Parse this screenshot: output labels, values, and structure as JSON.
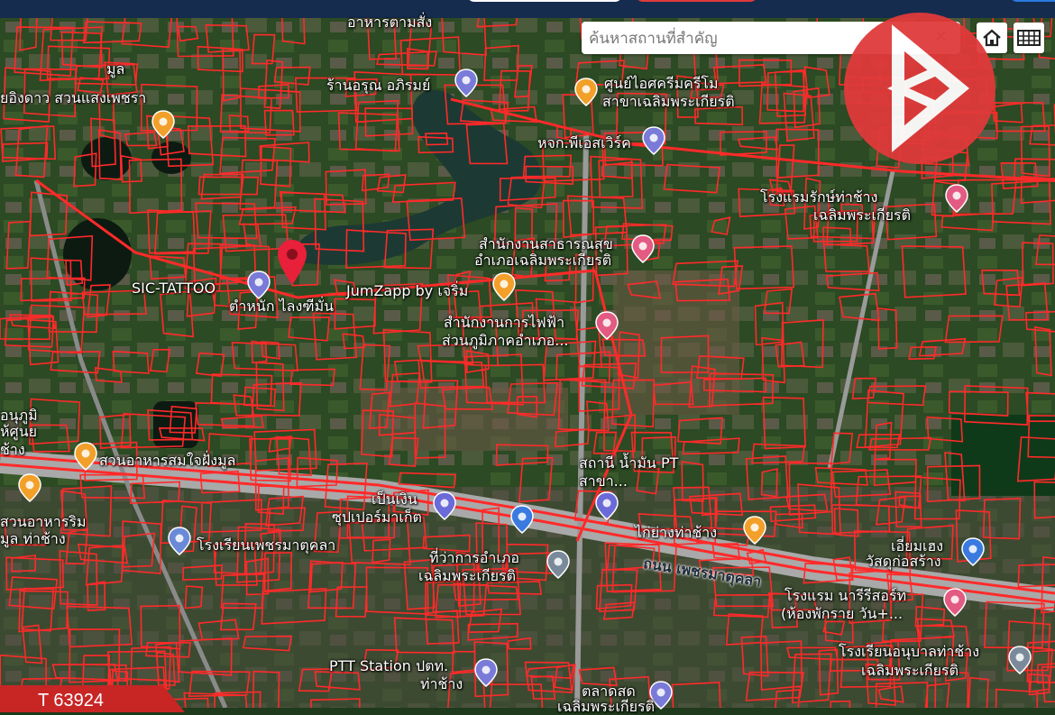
{
  "search": {
    "placeholder": "ค้นหาสถานที่สำคัญ",
    "value": ""
  },
  "controls": {
    "home_icon": "home-icon",
    "grid_icon": "grid-icon",
    "clear_icon": "close-icon"
  },
  "colors": {
    "parcel_lines": "#ff2a2a",
    "road": "#a9a9a9",
    "water": "#1c3a33",
    "logo": "#e03a3a",
    "marker": "#e8203a"
  },
  "labels": {
    "l1": "อาหารตามสั่ง",
    "l2": "มูล",
    "l3": "ยอิงดาว สวนแสงเพชรา",
    "l4": "ร้านอรุณ อภิรมย์",
    "l5": "ศูนย์ไอศครีมครีโม",
    "l6": "สาขาเฉลิมพระเกียรติ",
    "l7": "หจก.พีเอสเวิร์ค",
    "l8": "โรงแรมรักษ์ท่าช้าง",
    "l9": "เฉลิมพระเกียรติ",
    "l10": "สำนักงานสาธารณสุข",
    "l11": "อำเภอเฉลิมพระเกียรติ",
    "l12": "SIC-TATTOO",
    "l13": "ตำหนัก ไลงฑีมั่น",
    "l14": "JumZapp by เจริ่ม",
    "l15": "สำนักงานการไฟฟ้า",
    "l16": "ส่วนภูมิภาคอำเภอ...",
    "l17": "อนุภูมิ",
    "l18": "ห้ศูนย",
    "l19": "ช้าง",
    "l20": "สวนอาหารสมใจฝั่งมูล",
    "l21": "สถานี น้ำมัน PT",
    "l22": "สาขา...",
    "l23": "สวนอาหารริม",
    "l24": "มูล ท่าช้าง",
    "l25": "เป็นเงิน",
    "l26": "ซุปเปอร์มาเก็ต",
    "l27": "โรงเรียนเพชรมาตุคลา",
    "l28": "ไก่ย่างท่าช้าง",
    "l29": "ที่ว่าการอำเภอ",
    "l30": "เฉลิมพระเกียรติ",
    "l31": "ถนน เพชรมาตุคลา",
    "l32": "เอี่ยมเฮง",
    "l33": "วัสดุก่อสร้าง",
    "l34": "โรงแรม นารีรีสอร์ท",
    "l35": "(ห้องพักราย วัน+...",
    "l36": "โรงเรียนอนุบาลท่าช้าง",
    "l37": "เฉลิมพระเกียรติ",
    "l38": "PTT Station ปตท.",
    "l39": "ท่าช้าง",
    "l40": "ตลาดสด",
    "l41": "เฉลิมพระเกียรติ"
  },
  "listing_code": "T 63924"
}
